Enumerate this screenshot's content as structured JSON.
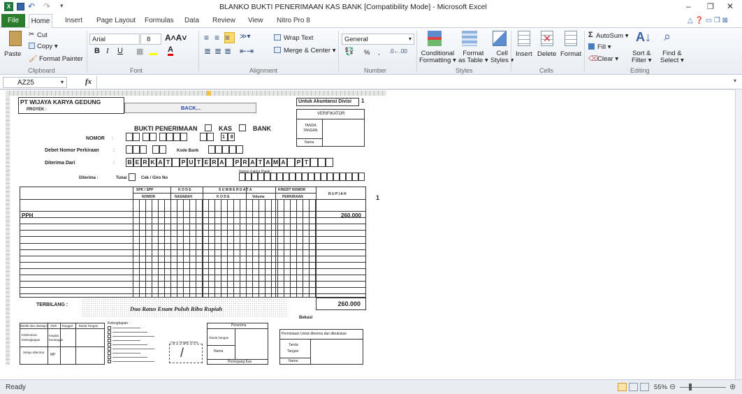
{
  "window": {
    "title": "BLANKO BUKTI PENERIMAAN KAS BANK  [Compatibility Mode]  -  Microsoft Excel",
    "quick_access": "▾",
    "controls": {
      "min": "–",
      "restore": "❐",
      "close": "✕"
    },
    "help_icons": "△ ❓ ▭ ❐ ⊠"
  },
  "tabs": [
    "File",
    "Home",
    "Insert",
    "Page Layout",
    "Formulas",
    "Data",
    "Review",
    "View",
    "Nitro Pro 8"
  ],
  "ribbon": {
    "clipboard": {
      "paste": "Paste",
      "cut": "Cut",
      "copy": "Copy ▾",
      "format_painter": "Format Painter",
      "label": "Clipboard"
    },
    "font": {
      "name": "Arial",
      "size": "8",
      "label": "Font"
    },
    "alignment": {
      "wrap": "Wrap Text",
      "merge": "Merge & Center ▾",
      "label": "Alignment"
    },
    "number": {
      "format": "General",
      "percent": "%",
      "comma": ",",
      "label": "Number"
    },
    "styles": {
      "conditional": "Conditional",
      "conditional2": "Formatting ▾",
      "format_table": "Format",
      "format_table2": "as Table ▾",
      "cell": "Cell",
      "cell2": "Styles ▾",
      "label": "Styles"
    },
    "cells": {
      "insert": "Insert",
      "delete": "Delete",
      "format": "Format",
      "label": "Cells"
    },
    "editing": {
      "autosum": "AutoSum ▾",
      "fill": "Fill ▾",
      "clear": "Clear ▾",
      "sort": "Sort &",
      "sort2": "Filter ▾",
      "find": "Find &",
      "find2": "Select ▾",
      "label": "Editing"
    }
  },
  "formula_bar": {
    "name_box": "AZ25",
    "fx": "fx",
    "value": ""
  },
  "sheet": {
    "company": "PT WIJAYA KARYA GEDUNG",
    "project": "PROYEK :",
    "back": "BACK...",
    "untuk": "Untuk Akuntansi Divisi",
    "untuk_num": "1",
    "verifikator": "VERIFIKATOR",
    "tanda": "TANDA",
    "tangan": "TANGAN",
    "nama": "Nama",
    "bukti": "BUKTI PENERIMAAN",
    "kas": "KAS",
    "bank": "BANK",
    "nomor": "NOMOR",
    "nomor_suffix": "1 8",
    "debet": "Debet Nomor Perkiraan",
    "kode_bank": "Kode Bank",
    "diterima_dari": "Diterima Dari",
    "payer_letters": [
      "B",
      "E",
      "R",
      "K",
      "A",
      "T",
      "",
      "P",
      "U",
      "T",
      "E",
      "R",
      "A",
      "",
      "P",
      "R",
      "A",
      "T",
      "A",
      "M",
      "A",
      "",
      "P",
      "T"
    ],
    "faktur": "Nomor Faktur Pajak :",
    "diterima": "Diterima :",
    "tunai": "Tunai",
    "cek": "Cek / Giro  No",
    "col_spk": "SPK / SPP",
    "col_nomor": "NOMOR",
    "col_kode": "K O D E",
    "col_nasabah": "NASABAH",
    "col_sumber": "S U M B E R   D A T A",
    "col_kode2": "K O D E",
    "col_volume": "Volume",
    "col_kredit": "KREDIT NOMOR",
    "col_perkiraan": "PERKIRAAN",
    "col_rupiah": "R U P I A H",
    "side_num": "1",
    "pph": "PPH",
    "pph_amount": "260.000",
    "terbilang": "TERBILANG :",
    "terbilang_text": "Dua Ratus  Enam Puluh  Ribu  Rupiah",
    "total": "260.000",
    "bekasi": "Bekasi",
    "diteliti": "Diteliti dan disetujui",
    "oleh": "Oleh",
    "tanggal": "Tanggal",
    "ttd": "Tanda Tangan",
    "kebenaran": "Kebenaran",
    "kelengkapan": "Kelengkapan",
    "kepala": "Kepala Keuangan",
    "setuju": "Setuju diterima",
    "mp": "MP",
    "kelengkapan_title": "Kelengkapan :",
    "cap": "Cap & Tanggal Terima",
    "penerima": "Penerima",
    "penerima_ttd": "Tanda Tangan",
    "penerima_nama": "Nama",
    "pemegang": "Pemegang Kas",
    "permintaan": "Permintaan Untuk diterima dan dibukukan",
    "perm_tanda": "Tanda",
    "perm_tangan": "Tangan",
    "perm_nama": "Nama"
  },
  "status": {
    "ready": "Ready",
    "zoom": "55%"
  }
}
